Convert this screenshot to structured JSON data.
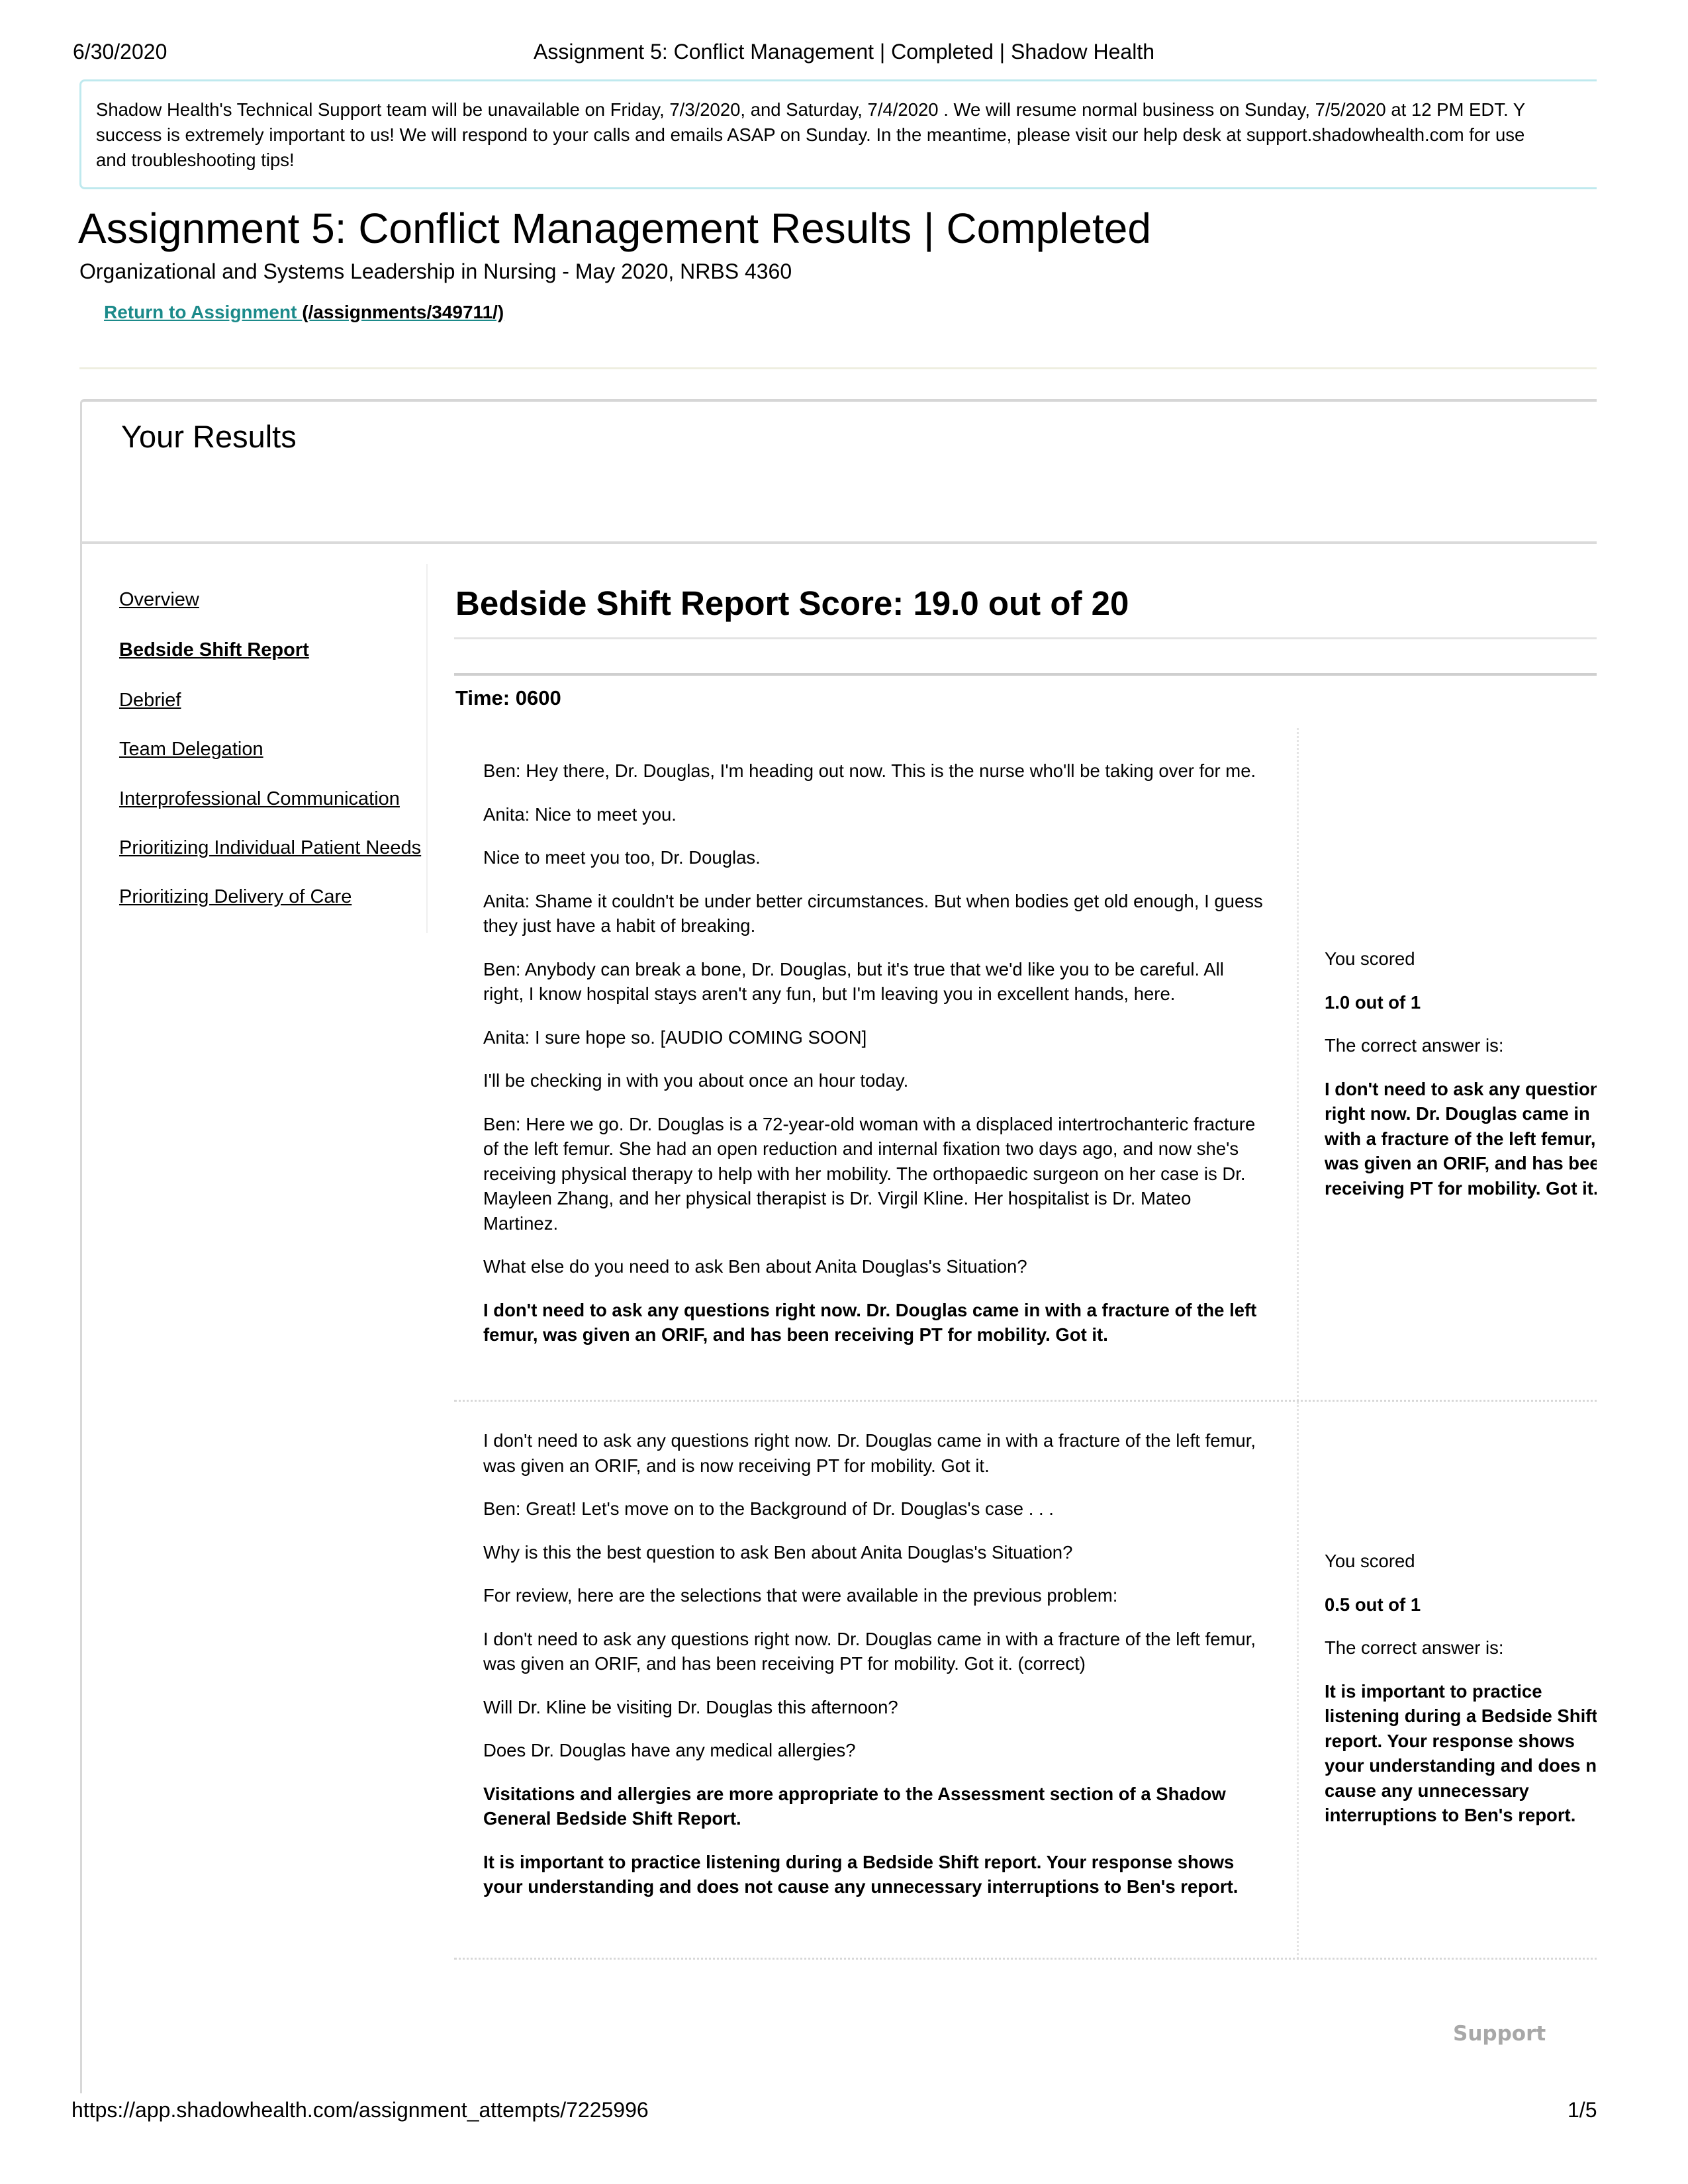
{
  "print_header": {
    "date": "6/30/2020",
    "title": "Assignment 5: Conflict Management | Completed | Shadow Health"
  },
  "banner": {
    "lines": [
      "Shadow Health's Technical Support team will be unavailable on Friday, 7/3/2020, and Saturday, 7/4/2020 . We will resume normal business on Sunday, 7/5/2020 at 12 PM EDT. Y",
      "success is extremely important to us! We will respond to your calls and emails ASAP on Sunday. In the meantime, please visit our help desk at support.shadowhealth.com for use",
      "and troubleshooting tips!"
    ]
  },
  "page": {
    "title": "Assignment 5: Conflict Management Results | Completed",
    "subtitle": "Organizational and Systems Leadership in Nursing - May 2020, NRBS 4360",
    "return_link_label": "Return to Assignment ",
    "return_link_path": "(/assignments/349711/)"
  },
  "results": {
    "title": "Your Results"
  },
  "sidebar": {
    "items": [
      {
        "label": "Overview",
        "active": false
      },
      {
        "label": "Bedside Shift Report",
        "active": true
      },
      {
        "label": "Debrief",
        "active": false
      },
      {
        "label": "Team Delegation",
        "active": false
      },
      {
        "label": "Interprofessional Communication",
        "active": false
      },
      {
        "label": "Prioritizing Individual Patient Needs",
        "active": false
      },
      {
        "label": "Prioritizing Delivery of Care",
        "active": false
      }
    ]
  },
  "main": {
    "heading": "Bedside Shift Report Score: 19.0 out of 20",
    "time_label": "Time: 0600",
    "blocks": [
      {
        "paragraphs": [
          {
            "text": "Ben: Hey there, Dr. Douglas, I'm heading out now. This is the nurse who'll be taking over for me.",
            "bold": false
          },
          {
            "text": "Anita: Nice to meet you.",
            "bold": false
          },
          {
            "text": "Nice to meet you too, Dr. Douglas.",
            "bold": false
          },
          {
            "text": "Anita: Shame it couldn't be under better circumstances. But when bodies get old enough, I guess they just have a habit of breaking.",
            "bold": false
          },
          {
            "text": "Ben: Anybody can break a bone, Dr. Douglas, but it's true that we'd like you to be careful. All right, I know hospital stays aren't any fun, but I'm leaving you in excellent hands, here.",
            "bold": false
          },
          {
            "text": "Anita: I sure hope so. [AUDIO COMING SOON]",
            "bold": false
          },
          {
            "text": "I'll be checking in with you about once an hour today.",
            "bold": false
          },
          {
            "text": "Ben: Here we go. Dr. Douglas is a 72-year-old woman with a displaced intertrochanteric fracture of the left femur. She had an open reduction and internal fixation two days ago, and now she's receiving physical therapy to help with her mobility. The orthopaedic surgeon on her case is Dr. Mayleen Zhang, and her physical therapist is Dr. Virgil Kline. Her hospitalist is Dr. Mateo Martinez.",
            "bold": false
          },
          {
            "text": "What else do you need to ask Ben about Anita Douglas's Situation?",
            "bold": false
          },
          {
            "text": "I don't need to ask any questions right now. Dr. Douglas came in with a fracture of the left femur, was given an ORIF, and has been receiving PT for mobility. Got it.",
            "bold": true
          }
        ],
        "score_label": "You scored",
        "score_value": "1.0 out of 1",
        "correct_label": "The correct answer is:",
        "correct_answer": "I don't need to ask any questions right now. Dr. Douglas came in with a fracture of the left femur, was given an ORIF, and has been receiving PT for mobility. Got it."
      },
      {
        "paragraphs": [
          {
            "text": "I don't need to ask any questions right now. Dr. Douglas came in with a fracture of the left femur, was given an ORIF, and is now receiving PT for mobility. Got it.",
            "bold": false
          },
          {
            "text": "Ben: Great! Let's move on to the Background of Dr. Douglas's case . . .",
            "bold": false
          },
          {
            "text": "Why is this the best question to ask Ben about Anita Douglas's Situation?",
            "bold": false
          },
          {
            "text": "For review, here are the selections that were available in the previous problem:",
            "bold": false
          },
          {
            "text": "I don't need to ask any questions right now. Dr. Douglas came in with a fracture of the left femur, was given an ORIF, and has been receiving PT for mobility. Got it. (correct)",
            "bold": false
          },
          {
            "text": "Will Dr. Kline be visiting Dr. Douglas this afternoon?",
            "bold": false
          },
          {
            "text": "Does Dr. Douglas have any medical allergies?",
            "bold": false
          },
          {
            "text": "Visitations and allergies are more appropriate to the Assessment section of a Shadow General Bedside Shift Report.",
            "bold": true
          },
          {
            "text": "It is important to practice listening during a Bedside Shift report. Your response shows your understanding and does not cause any unnecessary interruptions to Ben's report.",
            "bold": true
          }
        ],
        "score_label": "You scored",
        "score_value": "0.5 out of 1",
        "correct_label": "The correct answer is:",
        "correct_answer": "It is important to practice listening during a Bedside Shift report. Your response shows your understanding and does not cause any unnecessary interruptions to Ben's report."
      }
    ]
  },
  "support_label": "Support",
  "print_footer": {
    "url": "https://app.shadowhealth.com/assignment_attempts/7225996",
    "page": "1/5"
  },
  "colors": {
    "link": "#1b8a8a",
    "banner_border": "#bfe9ee",
    "support_text": "#a8a8a8"
  }
}
